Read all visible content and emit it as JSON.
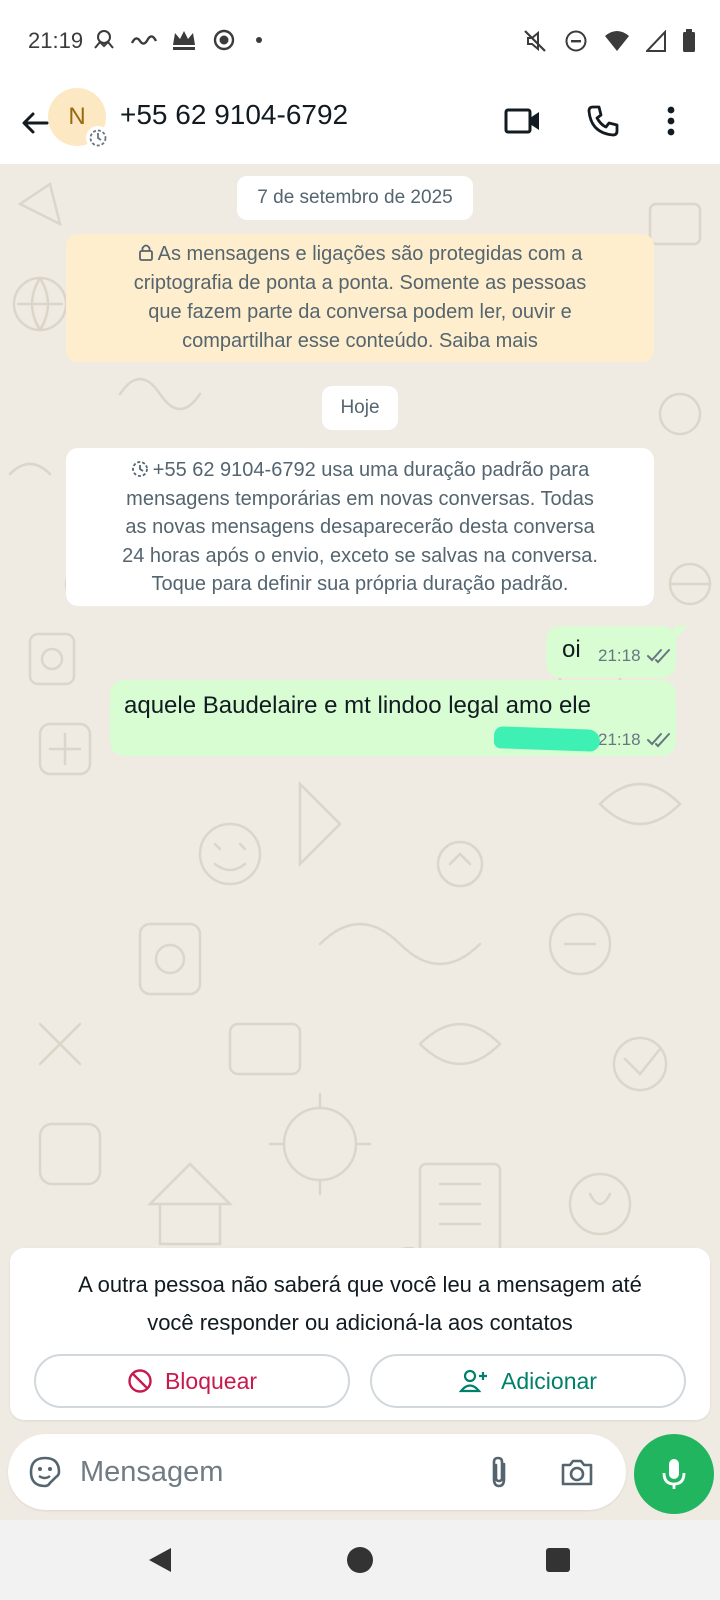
{
  "status_bar": {
    "time": "21:19",
    "icons": [
      "game-notification-icon",
      "ifood-notification-icon",
      "crown-notification-icon",
      "record-notification-icon",
      "more-dot-icon",
      "mute-icon",
      "dnd-icon",
      "wifi-icon",
      "signal-icon",
      "battery-icon"
    ]
  },
  "header": {
    "avatar_letter": "N",
    "contact": "+55 62 9104-6792",
    "icons": [
      "back-arrow-icon",
      "video-call-icon",
      "voice-call-icon",
      "more-vert-icon"
    ]
  },
  "chat": {
    "date_chip": "7 de setembro de 2025",
    "encryption_notice": {
      "lines": [
        "As mensagens e ligações são protegidas com a",
        "criptografia de ponta a ponta. Somente as pessoas",
        "que fazem parte da conversa podem ler, ouvir e",
        "compartilhar esse conteúdo."
      ],
      "link": "Saiba mais"
    },
    "today_chip": "Hoje",
    "system_notice": {
      "lines": [
        "+55 62 9104-6792 usa uma duração padrão para",
        "mensagens temporárias em novas conversas. Todas",
        "as novas mensagens desaparecerão desta conversa",
        "24 horas após o envio, exceto se salvas na conversa.",
        "Toque para definir sua própria duração padrão."
      ]
    },
    "messages": [
      {
        "text": "oi",
        "time": "21:18",
        "status": "delivered"
      },
      {
        "text": "aquele Baudelaire e mt lindoo legal amo ele",
        "time": "21:18",
        "status": "delivered"
      }
    ]
  },
  "unknown_contact_card": {
    "line1": "A outra pessoa não saberá que você leu a mensagem até",
    "line2": "você responder ou adicioná-la aos contatos",
    "block_label": "Bloquear",
    "add_label": "Adicionar"
  },
  "composer": {
    "placeholder": "Mensagem",
    "value": ""
  },
  "colors": {
    "outgoing_bubble": "#d9fdd3",
    "chat_background": "#efeae2",
    "encryption_notice_bg": "#ffeecd",
    "mic_button": "#21b55f",
    "block_red": "#c8194a",
    "add_green": "#008069"
  }
}
